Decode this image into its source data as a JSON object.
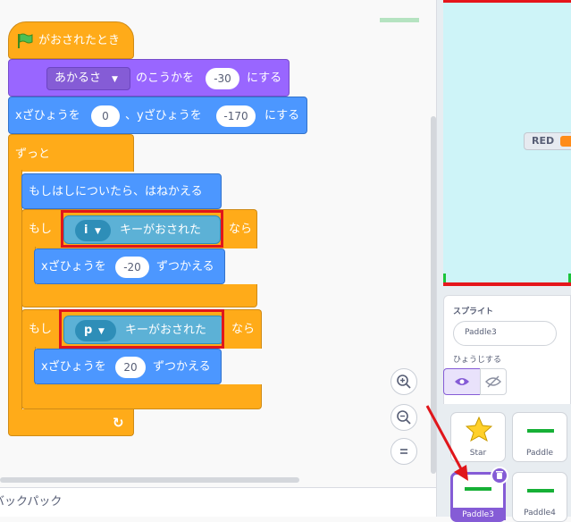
{
  "script": {
    "hat_label": "がおされたとき",
    "effect": {
      "dropdown": "あかるさ",
      "middle": "のこうかを",
      "value": "-30",
      "suffix": "にする"
    },
    "goto": {
      "x_label": "xざひょうを",
      "x_value": "0",
      "y_label": "、yざひょうを",
      "y_value": "-170",
      "suffix": "にする"
    },
    "forever_label": "ずっと",
    "bounce_label": "もしはしについたら、はねかえる",
    "if1": {
      "if_label": "もし",
      "key": "i",
      "pressed_label": "キーがおされた",
      "then_label": "なら",
      "change_label": "xざひょうを",
      "change_value": "-20",
      "change_suffix": "ずつかえる"
    },
    "if2": {
      "if_label": "もし",
      "key": "p",
      "pressed_label": "キーがおされた",
      "then_label": "なら",
      "change_label": "xざひょうを",
      "change_value": "20",
      "change_suffix": "ずつかえる"
    }
  },
  "zoom": {
    "zoom_in": "+",
    "zoom_out": "−",
    "reset": "="
  },
  "backpack_label": "バックパック",
  "stage": {
    "variable_name": "RED"
  },
  "sprite_info": {
    "title": "スプライト",
    "name_value": "Paddle3",
    "show_label": "ひょうじする"
  },
  "sprites": [
    {
      "name": "Star"
    },
    {
      "name": "Paddle"
    },
    {
      "name": "Paddle3"
    },
    {
      "name": "Paddle4"
    }
  ],
  "colors": {
    "events": "#ffab19",
    "motion": "#4c97ff",
    "looks": "#9966ff",
    "sensing": "#5cb1d6",
    "highlight": "#e0161b",
    "selected": "#855cd6"
  }
}
